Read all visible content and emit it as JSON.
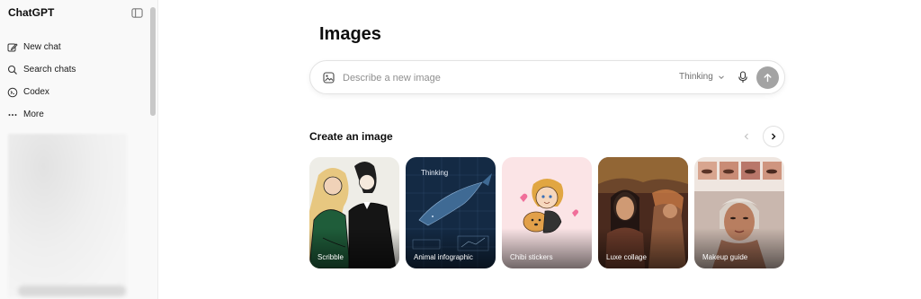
{
  "sidebar": {
    "brand": "ChatGPT",
    "items": [
      {
        "label": "New chat",
        "icon": "edit-icon"
      },
      {
        "label": "Search chats",
        "icon": "search-icon"
      },
      {
        "label": "Codex",
        "icon": "codex-icon"
      },
      {
        "label": "More",
        "icon": "more-icon"
      }
    ]
  },
  "main": {
    "title": "Images",
    "composer": {
      "placeholder": "Describe a new image",
      "model": "Thinking"
    },
    "section_title": "Create an image",
    "cards": [
      {
        "label": "Scribble"
      },
      {
        "label": "Animal infographic",
        "overlay": "Thinking"
      },
      {
        "label": "Chibi stickers"
      },
      {
        "label": "Luxe collage"
      },
      {
        "label": "Makeup guide"
      }
    ]
  },
  "colors": {
    "send_button": "#a3a3a3",
    "sidebar_bg": "#f9f9f9"
  }
}
